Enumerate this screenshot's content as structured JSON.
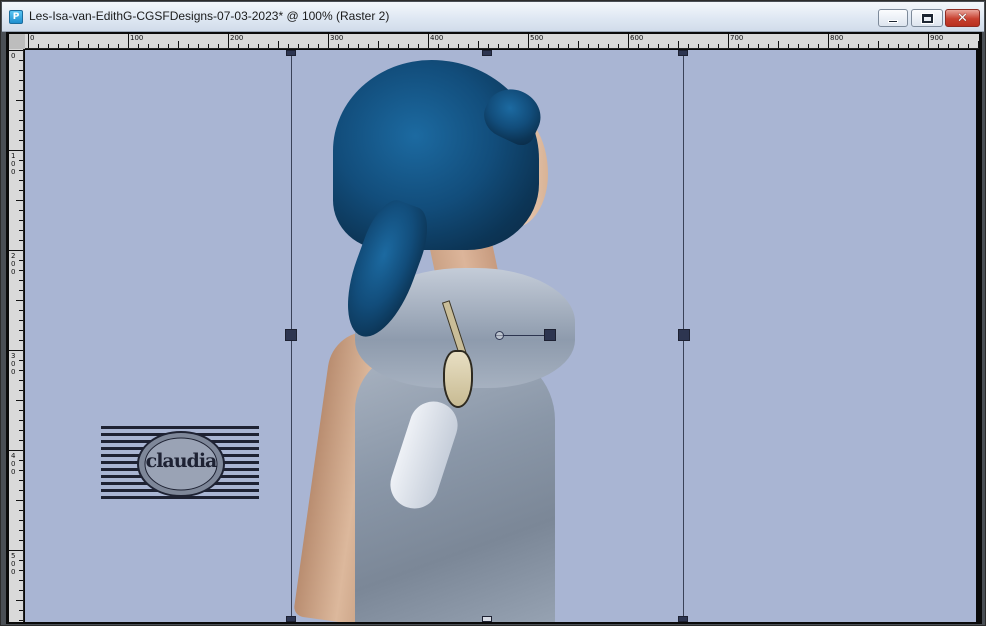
{
  "window": {
    "title": "Les-Isa-van-EdithG-CGSFDesigns-07-03-2023* @ 100% (Raster 2)",
    "controls": {
      "minimize": "minimize",
      "maximize": "maximize",
      "close": "✕"
    }
  },
  "rulers": {
    "top_labels": [
      "0",
      "100",
      "200",
      "300",
      "400",
      "500",
      "600",
      "700",
      "800",
      "900"
    ],
    "left_labels": [
      "0",
      "1\n0\n0",
      "2\n0\n0",
      "3\n0\n0",
      "4\n0\n0",
      "5\n0\n0"
    ]
  },
  "canvas": {
    "background": "#a9b5d3",
    "watermark_text": "claudia"
  },
  "colors": {
    "hair": "#124d7b",
    "selection": "#2d3550",
    "close_button": "#c8402f"
  }
}
